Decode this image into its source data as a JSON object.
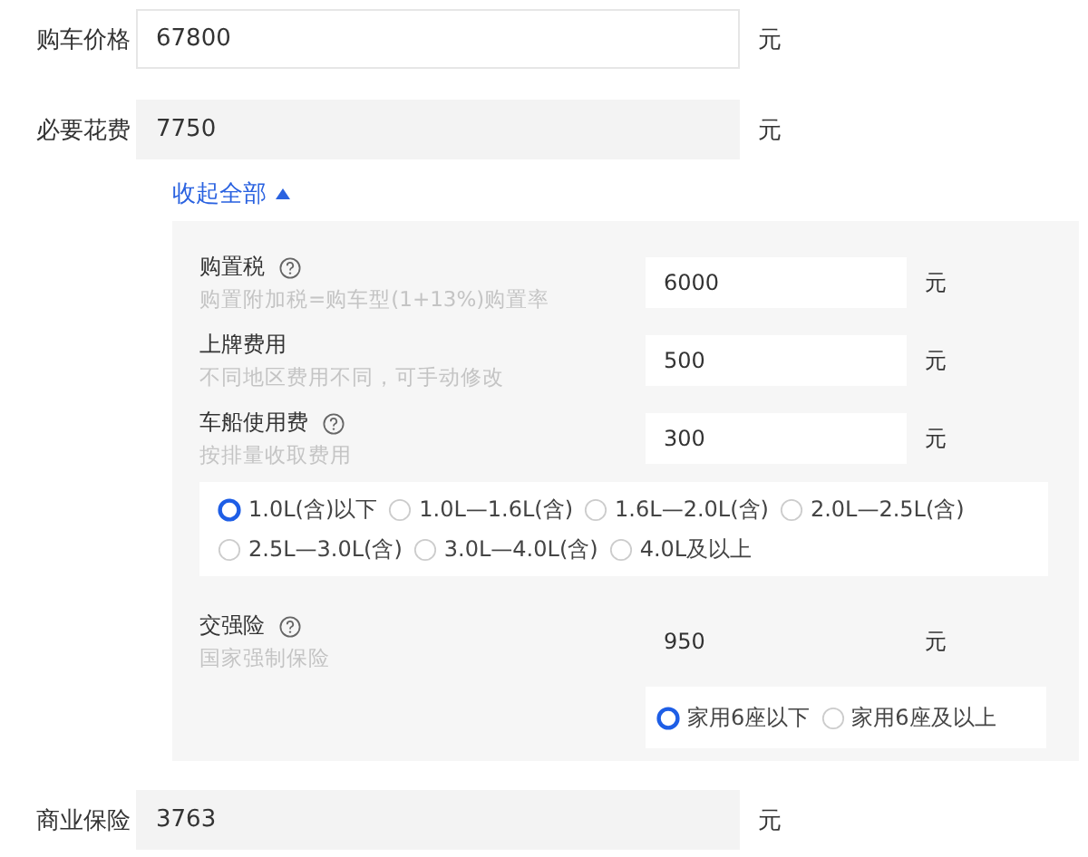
{
  "top_fields": [
    {
      "label": "购车价格",
      "value": "67800",
      "unit": "元",
      "readonly": false
    },
    {
      "label": "必要花费",
      "value": "7750",
      "unit": "元",
      "readonly": true
    }
  ],
  "toggle": {
    "label": "收起全部",
    "expanded": true
  },
  "details": [
    {
      "label": "购置税",
      "help": true,
      "hint": "购置附加税=购车型(1+13%)购置率",
      "value": "6000",
      "unit": "元",
      "readonly": false
    },
    {
      "label": "上牌费用",
      "help": false,
      "hint": "不同地区费用不同，可手动修改",
      "value": "500",
      "unit": "元",
      "readonly": false
    },
    {
      "label": "车船使用费",
      "help": true,
      "hint": "按排量收取费用",
      "value": "300",
      "unit": "元",
      "readonly": false,
      "options": [
        {
          "label": "1.0L(含)以下",
          "selected": true
        },
        {
          "label": "1.0L—1.6L(含)",
          "selected": false
        },
        {
          "label": "1.6L—2.0L(含)",
          "selected": false
        },
        {
          "label": "2.0L—2.5L(含)",
          "selected": false
        },
        {
          "label": "2.5L—3.0L(含)",
          "selected": false
        },
        {
          "label": "3.0L—4.0L(含)",
          "selected": false
        },
        {
          "label": "4.0L及以上",
          "selected": false
        }
      ]
    },
    {
      "label": "交强险",
      "help": true,
      "hint": "国家强制保险",
      "value": "950",
      "unit": "元",
      "readonly": true,
      "options": [
        {
          "label": "家用6座以下",
          "selected": true
        },
        {
          "label": "家用6座及以上",
          "selected": false
        }
      ]
    }
  ],
  "bottom_fields": [
    {
      "label": "商业保险",
      "value": "3763",
      "unit": "元",
      "readonly": true
    }
  ]
}
